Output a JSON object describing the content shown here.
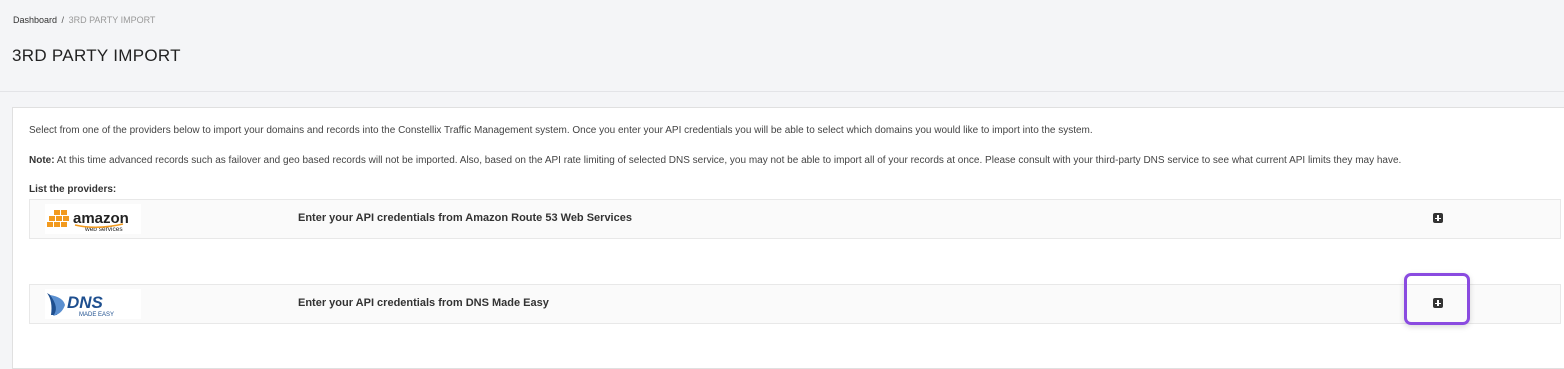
{
  "breadcrumb": {
    "home": "Dashboard",
    "separator": "/",
    "current": "3RD PARTY IMPORT"
  },
  "page": {
    "title": "3RD PARTY IMPORT"
  },
  "content": {
    "intro": "Select from one of the providers below to import your domains and records into the Constellix Traffic Management system. Once you enter your API credentials you will be able to select which domains you would like to import into the system.",
    "note_label": "Note:",
    "note_text": " At this time advanced records such as failover and geo based records will not be imported. Also, based on the API rate limiting of selected DNS service, you may not be able to import all of your records at once. Please consult with your third-party DNS service to see what current API limits they may have.",
    "providers_label": "List the providers:"
  },
  "providers": [
    {
      "name_logo_text": "amazon",
      "logo_subtext": "web services",
      "description": "Enter your API credentials from Amazon Route 53 Web Services",
      "icon": "plus-square-icon"
    },
    {
      "name_logo_text": "DNS",
      "logo_subtext": "MADE EASY",
      "description": "Enter your API credentials from DNS Made Easy",
      "icon": "plus-square-icon"
    }
  ],
  "colors": {
    "highlight": "#8a4be0",
    "amazon_orange": "#f29a1e",
    "dns_blue": "#1e4f8f"
  }
}
